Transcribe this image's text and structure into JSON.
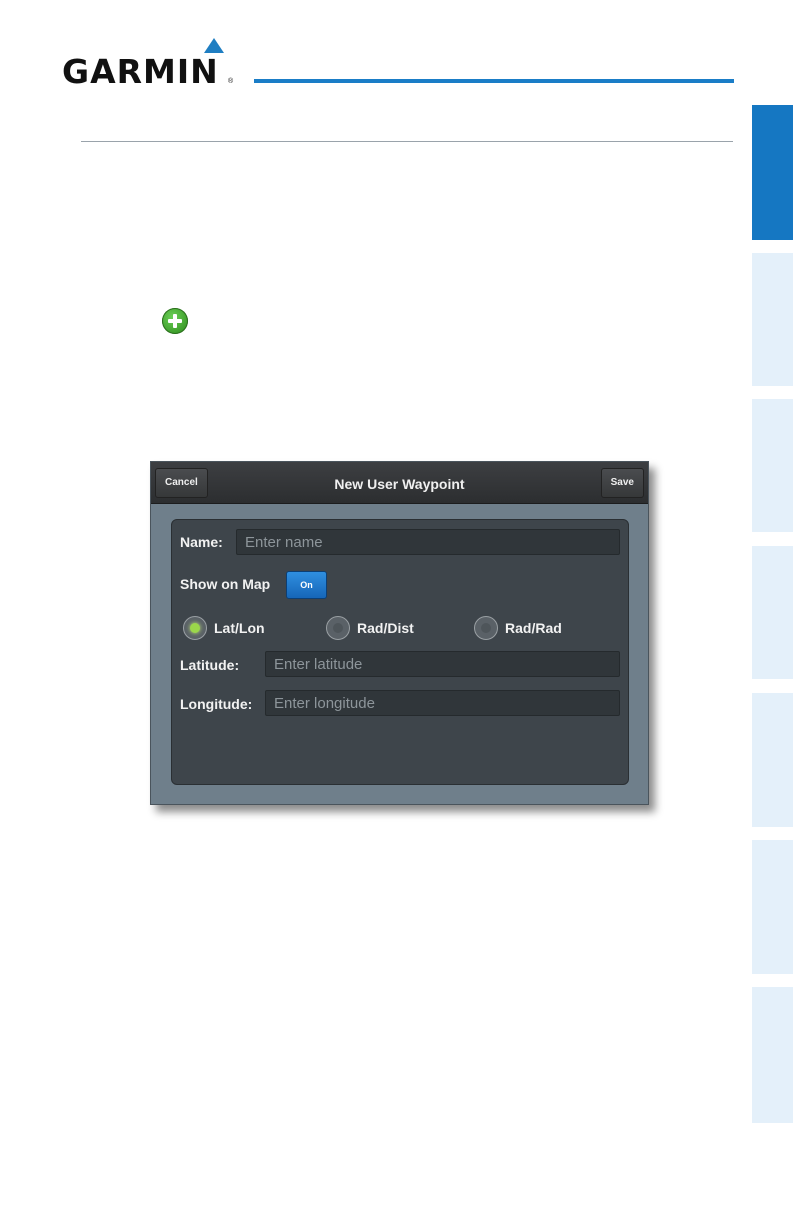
{
  "brand": {
    "name": "GARMIN",
    "reg_mark": "®",
    "delta_color": "#1f7ec2"
  },
  "colors": {
    "accent": "#1577c2",
    "tab_inactive": "#e4f0fa",
    "plus_icon": "#3d9e2b"
  },
  "icons": {
    "add": "plus-circle-icon"
  },
  "dialog": {
    "title": "New User Waypoint",
    "cancel_label": "Cancel",
    "save_label": "Save",
    "name_label": "Name:",
    "name_placeholder": "Enter name",
    "show_on_map_label": "Show on Map",
    "show_on_map_value": "On",
    "modes": [
      {
        "label": "Lat/Lon",
        "selected": true
      },
      {
        "label": "Rad/Dist",
        "selected": false
      },
      {
        "label": "Rad/Rad",
        "selected": false
      }
    ],
    "latitude_label": "Latitude:",
    "latitude_placeholder": "Enter latitude",
    "longitude_label": "Longitude:",
    "longitude_placeholder": "Enter longitude"
  }
}
